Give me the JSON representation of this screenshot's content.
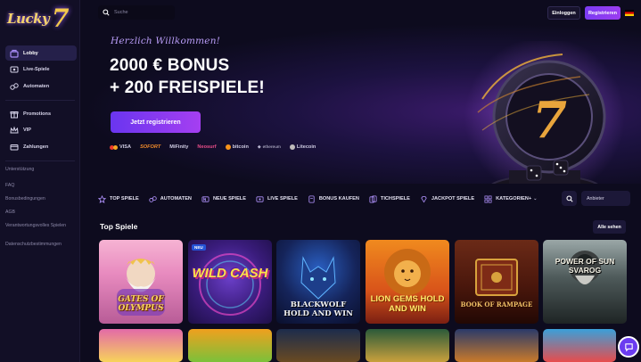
{
  "brand": {
    "logo_text": "Lucky",
    "logo_number": "7"
  },
  "sidebar": {
    "main_items": [
      {
        "label": "Lobby",
        "icon": "lobby-icon"
      },
      {
        "label": "Live-Spiele",
        "icon": "live-icon"
      },
      {
        "label": "Automaten",
        "icon": "slot-machine-icon"
      }
    ],
    "secondary_items": [
      {
        "label": "Promotions",
        "icon": "gift-icon"
      },
      {
        "label": "VIP",
        "icon": "crown-icon"
      },
      {
        "label": "Zahlungen",
        "icon": "payment-card-icon"
      }
    ],
    "links": [
      "Unterstützung",
      "FAQ",
      "Bonusbedingungen",
      "AGB",
      "Verantwortungsvolles Spielen",
      "Datenschutzbestimmungen"
    ]
  },
  "topbar": {
    "search_placeholder": "Suche",
    "login_label": "Einloggen",
    "register_label": "Registrieren"
  },
  "hero": {
    "welcome": "Herzlich Willkommen!",
    "bonus_line1": "2000 € BONUS",
    "bonus_line2": "+ 200 FREISPIELE!",
    "cta_label": "Jetzt registrieren",
    "payments": [
      "VISA",
      "SOFORT",
      "MiFinity",
      "Neosurf",
      "bitcoin",
      "ethereum",
      "Litecoin"
    ]
  },
  "categories": [
    {
      "label": "TOP SPIELE",
      "icon": "star-icon"
    },
    {
      "label": "AUTOMATEN",
      "icon": "slot-machine-icon"
    },
    {
      "label": "NEUE SPIELE",
      "icon": "new-badge-icon"
    },
    {
      "label": "LIVE SPIELE",
      "icon": "live-icon"
    },
    {
      "label": "BONUS KAUFEN",
      "icon": "bonus-icon"
    },
    {
      "label": "TICHSPIELE",
      "icon": "cards-icon"
    },
    {
      "label": "JACKPOT SPIELE",
      "icon": "diamond-icon"
    },
    {
      "label": "KATEGORIEN+",
      "icon": "grid-icon"
    }
  ],
  "provider_label": "Anbieter",
  "top_games": {
    "title": "Top Spiele",
    "all_label": "Alle sehen",
    "games": [
      {
        "name": "GATES OF OLYMPUS",
        "badge": ""
      },
      {
        "name": "WILD CASH",
        "badge": "NEU"
      },
      {
        "name": "BLACKWOLF HOLD AND WIN",
        "badge": ""
      },
      {
        "name": "LION GEMS HOLD AND WIN",
        "badge": ""
      },
      {
        "name": "BOOK OF RAMPAGE",
        "badge": ""
      },
      {
        "name": "POWER OF SUN SVAROG",
        "badge": ""
      }
    ]
  },
  "colors": {
    "accent": "#7b3cf2",
    "background": "#0d0b1e",
    "sidebar": "#120f26"
  }
}
